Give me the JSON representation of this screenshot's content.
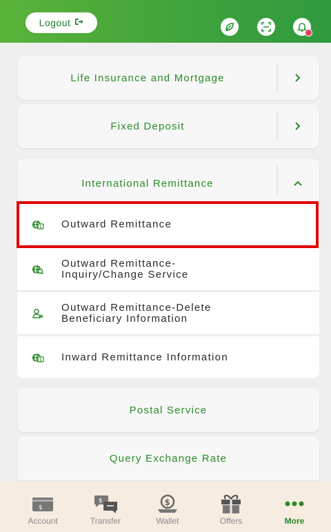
{
  "header": {
    "logout_label": "Logout",
    "icons": [
      "leaf-icon",
      "scan-icon",
      "bell-icon"
    ]
  },
  "menu": {
    "life_insurance": "Life Insurance and Mortgage",
    "fixed_deposit": "Fixed Deposit",
    "international_remittance": "International Remittance",
    "postal_service": "Postal Service",
    "query_exchange_rate": "Query Exchange Rate"
  },
  "remittance_items": [
    {
      "line1": "Outward Remittance",
      "line2": ""
    },
    {
      "line1": "Outward Remittance-",
      "line2": "Inquiry/Change Service"
    },
    {
      "line1": "Outward Remittance-Delete",
      "line2": "Beneficiary Information"
    },
    {
      "line1": "Inward Remittance Information",
      "line2": ""
    }
  ],
  "nav": {
    "account": "Account",
    "transfer": "Transfer",
    "wallet": "Wallet",
    "offers": "Offers",
    "more": "More"
  },
  "colors": {
    "brand_green": "#3fa23c",
    "text_green": "#2a8a2a",
    "highlight_red": "#e00000",
    "nav_bg": "#f7ece0"
  }
}
